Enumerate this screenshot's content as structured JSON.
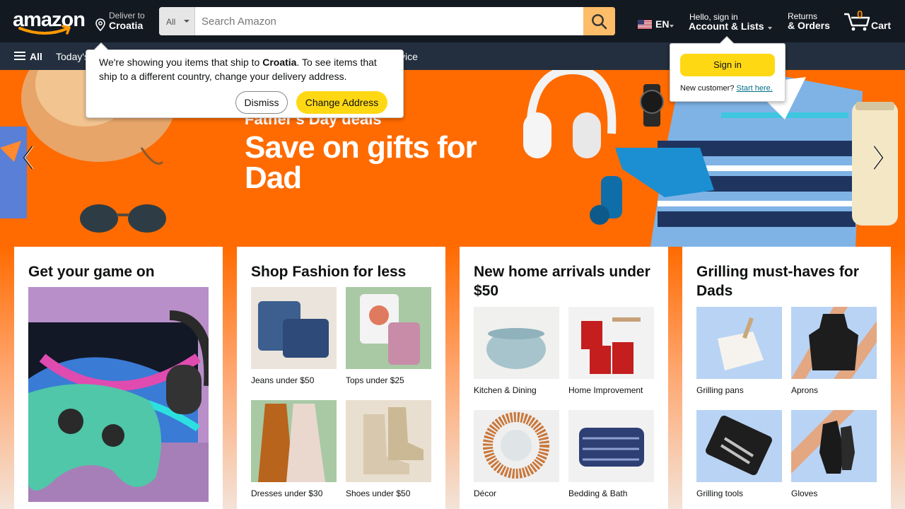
{
  "nav": {
    "logo_text": "amazon",
    "deliver_line1": "Deliver to",
    "deliver_line2": "Croatia",
    "search_category": "All",
    "search_placeholder": "Search Amazon",
    "language": "EN",
    "account_line1": "Hello, sign in",
    "account_line2": "Account & Lists",
    "returns_line1": "Returns",
    "returns_line2": "& Orders",
    "cart_count": "0",
    "cart_label": "Cart"
  },
  "subnav": {
    "all_label": "All",
    "items": [
      "Today's",
      "vice"
    ]
  },
  "ship_popover": {
    "msg_pre": "We're showing you items that ship to ",
    "country": "Croatia",
    "msg_post": ". To see items that ship to a different country, change your delivery address.",
    "dismiss_label": "Dismiss",
    "change_label": "Change Address"
  },
  "signin_popover": {
    "button_label": "Sign in",
    "new_customer": "New customer?",
    "start_link": "Start here."
  },
  "hero": {
    "subtitle": "Father's Day deals",
    "title": "Save on gifts for Dad"
  },
  "cards": [
    {
      "title": "Get your game on"
    },
    {
      "title": "Shop Fashion for less",
      "tiles": [
        "Jeans under $50",
        "Tops under $25",
        "Dresses under $30",
        "Shoes under $50"
      ]
    },
    {
      "title": "New home arrivals under $50",
      "tiles": [
        "Kitchen & Dining",
        "Home Improvement",
        "Décor",
        "Bedding & Bath"
      ]
    },
    {
      "title": "Grilling must-haves for Dads",
      "tiles": [
        "Grilling pans",
        "Aprons",
        "Grilling tools",
        "Gloves"
      ]
    }
  ],
  "colors": {
    "nav_bg": "#131921",
    "subnav_bg": "#232f3e",
    "search_button": "#febd69",
    "primary_button": "#ffd814",
    "hero_orange": "#ff6b00",
    "cart_count": "#f08804",
    "link": "#007185"
  },
  "icons": [
    "location-pin-icon",
    "search-icon",
    "cart-icon",
    "hamburger-icon",
    "chevron-left-icon",
    "chevron-right-icon",
    "us-flag-icon"
  ]
}
